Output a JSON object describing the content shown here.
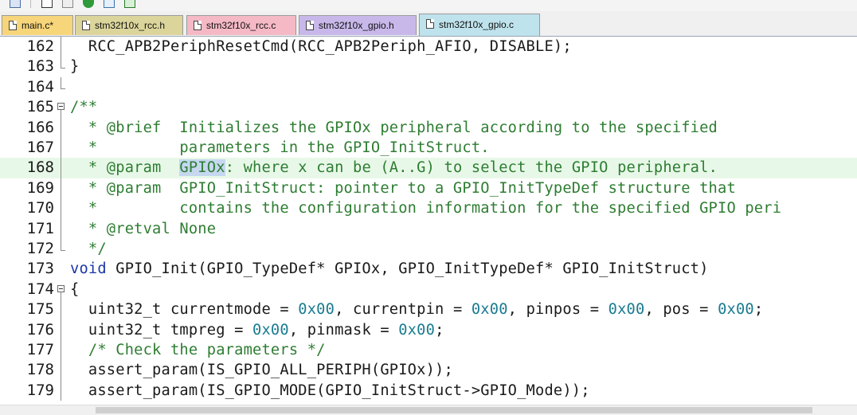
{
  "tabs": [
    {
      "label": "main.c*",
      "color": "#f7d57a",
      "active": false
    },
    {
      "label": "stm32f10x_rcc.h",
      "color": "#dcd59b",
      "active": false
    },
    {
      "label": "stm32f10x_rcc.c",
      "color": "#f5b9c6",
      "active": false
    },
    {
      "label": "stm32f10x_gpio.h",
      "color": "#c8b8ea",
      "active": false
    },
    {
      "label": "stm32f10x_gpio.c",
      "color": "#bfe3ec",
      "active": true
    }
  ],
  "lines": [
    {
      "num": "162",
      "text": "  RCC_APB2PeriphResetCmd(RCC_APB2Periph_AFIO, DISABLE);"
    },
    {
      "num": "163",
      "text": "}"
    },
    {
      "num": "164",
      "text": ""
    },
    {
      "num": "165",
      "text": "/**"
    },
    {
      "num": "166",
      "text": "  * @brief  Initializes the GPIOx peripheral according to the specified"
    },
    {
      "num": "167",
      "text": "  *         parameters in the GPIO_InitStruct."
    },
    {
      "num": "168",
      "text_selected": "GPIOx",
      "text_before": "  * @param  ",
      "text_after": ": where x can be (A..G) to select the GPIO peripheral."
    },
    {
      "num": "169",
      "text": "  * @param  GPIO_InitStruct: pointer to a GPIO_InitTypeDef structure that"
    },
    {
      "num": "170",
      "text": "  *         contains the configuration information for the specified GPIO peri"
    },
    {
      "num": "171",
      "text": "  * @retval None"
    },
    {
      "num": "172",
      "text": "  */"
    },
    {
      "num": "173",
      "kw": "void",
      "text": " GPIO_Init(GPIO_TypeDef* GPIOx, GPIO_InitTypeDef* GPIO_InitStruct)"
    },
    {
      "num": "174",
      "text": "{"
    },
    {
      "num": "175",
      "p1": "  uint32_t currentmode = ",
      "n1": "0x00",
      "p2": ", currentpin = ",
      "n2": "0x00",
      "p3": ", pinpos = ",
      "n3": "0x00",
      "p4": ", pos = ",
      "n4": "0x00",
      "p5": ";"
    },
    {
      "num": "176",
      "p1": "  uint32_t tmpreg = ",
      "n1": "0x00",
      "p2": ", pinmask = ",
      "n2": "0x00",
      "p3": ";"
    },
    {
      "num": "177",
      "text": "  /* Check the parameters */"
    },
    {
      "num": "178",
      "text": "  assert_param(IS_GPIO_ALL_PERIPH(GPIOx));"
    },
    {
      "num": "179",
      "text": "  assert_param(IS_GPIO_MODE(GPIO_InitStruct->GPIO_Mode));"
    }
  ]
}
